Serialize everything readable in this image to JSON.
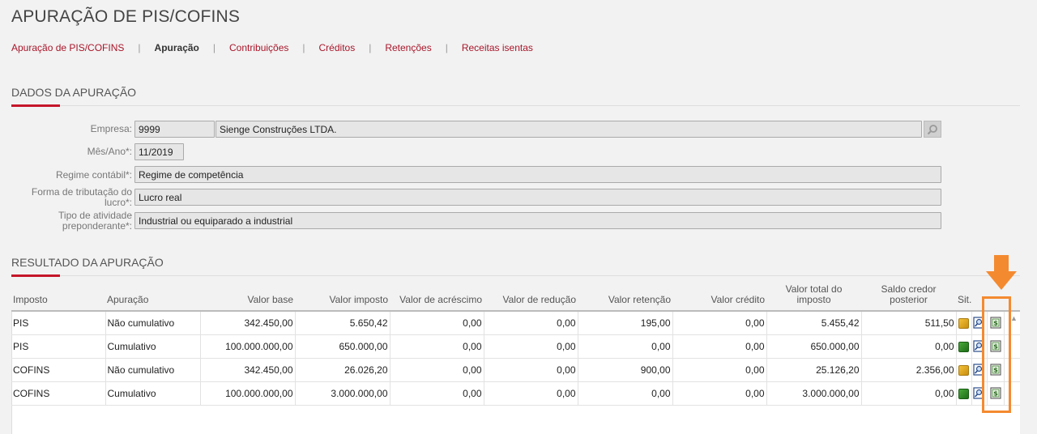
{
  "page_title": "APURAÇÃO DE PIS/COFINS",
  "tabs": [
    {
      "label": "Apuração de PIS/COFINS",
      "active": false
    },
    {
      "label": "Apuração",
      "active": true
    },
    {
      "label": "Contribuições",
      "active": false
    },
    {
      "label": "Créditos",
      "active": false
    },
    {
      "label": "Retenções",
      "active": false
    },
    {
      "label": "Receitas isentas",
      "active": false
    }
  ],
  "dados": {
    "title": "DADOS DA APURAÇÃO",
    "empresa_label": "Empresa:",
    "empresa_code": "9999",
    "empresa_name": "Sienge Construções LTDA.",
    "mes_ano_label": "Mês/Ano*:",
    "mes_ano": "11/2019",
    "regime_label": "Regime contábil*:",
    "regime": "Regime de competência",
    "forma_label_1": "Forma de tributação do",
    "forma_label_2": "lucro*:",
    "forma": "Lucro real",
    "tipo_label_1": "Tipo de atividade",
    "tipo_label_2": "preponderante*:",
    "tipo": "Industrial ou equiparado a industrial"
  },
  "resultado": {
    "title": "RESULTADO DA APURAÇÃO",
    "headers": {
      "imposto": "Imposto",
      "apuracao": "Apuração",
      "valor_base": "Valor base",
      "valor_imposto": "Valor imposto",
      "valor_acrescimo": "Valor de acréscimo",
      "valor_reducao": "Valor de redução",
      "valor_retencao": "Valor retenção",
      "valor_credito": "Valor crédito",
      "valor_total_1": "Valor total do",
      "valor_total_2": "imposto",
      "saldo_1": "Saldo credor",
      "saldo_2": "posterior",
      "sit": "Sit."
    },
    "rows": [
      {
        "imposto": "PIS",
        "apuracao": "Não cumulativo",
        "valor_base": "342.450,00",
        "valor_imposto": "5.650,42",
        "acrescimo": "0,00",
        "reducao": "0,00",
        "retencao": "195,00",
        "credito": "0,00",
        "total": "5.455,42",
        "saldo": "511,50",
        "status": "yellow"
      },
      {
        "imposto": "PIS",
        "apuracao": "Cumulativo",
        "valor_base": "100.000.000,00",
        "valor_imposto": "650.000,00",
        "acrescimo": "0,00",
        "reducao": "0,00",
        "retencao": "0,00",
        "credito": "0,00",
        "total": "650.000,00",
        "saldo": "0,00",
        "status": "green"
      },
      {
        "imposto": "COFINS",
        "apuracao": "Não cumulativo",
        "valor_base": "342.450,00",
        "valor_imposto": "26.026,20",
        "acrescimo": "0,00",
        "reducao": "0,00",
        "retencao": "900,00",
        "credito": "0,00",
        "total": "25.126,20",
        "saldo": "2.356,00",
        "status": "yellow"
      },
      {
        "imposto": "COFINS",
        "apuracao": "Cumulativo",
        "valor_base": "100.000.000,00",
        "valor_imposto": "3.000.000,00",
        "acrescimo": "0,00",
        "reducao": "0,00",
        "retencao": "0,00",
        "credito": "0,00",
        "total": "3.000.000,00",
        "saldo": "0,00",
        "status": "green"
      }
    ]
  },
  "colors": {
    "accent": "#c5162a",
    "tab_link": "#a8162a",
    "highlight": "#f48a30",
    "status_yellow": "#e0a521",
    "status_green": "#2f8a26"
  }
}
